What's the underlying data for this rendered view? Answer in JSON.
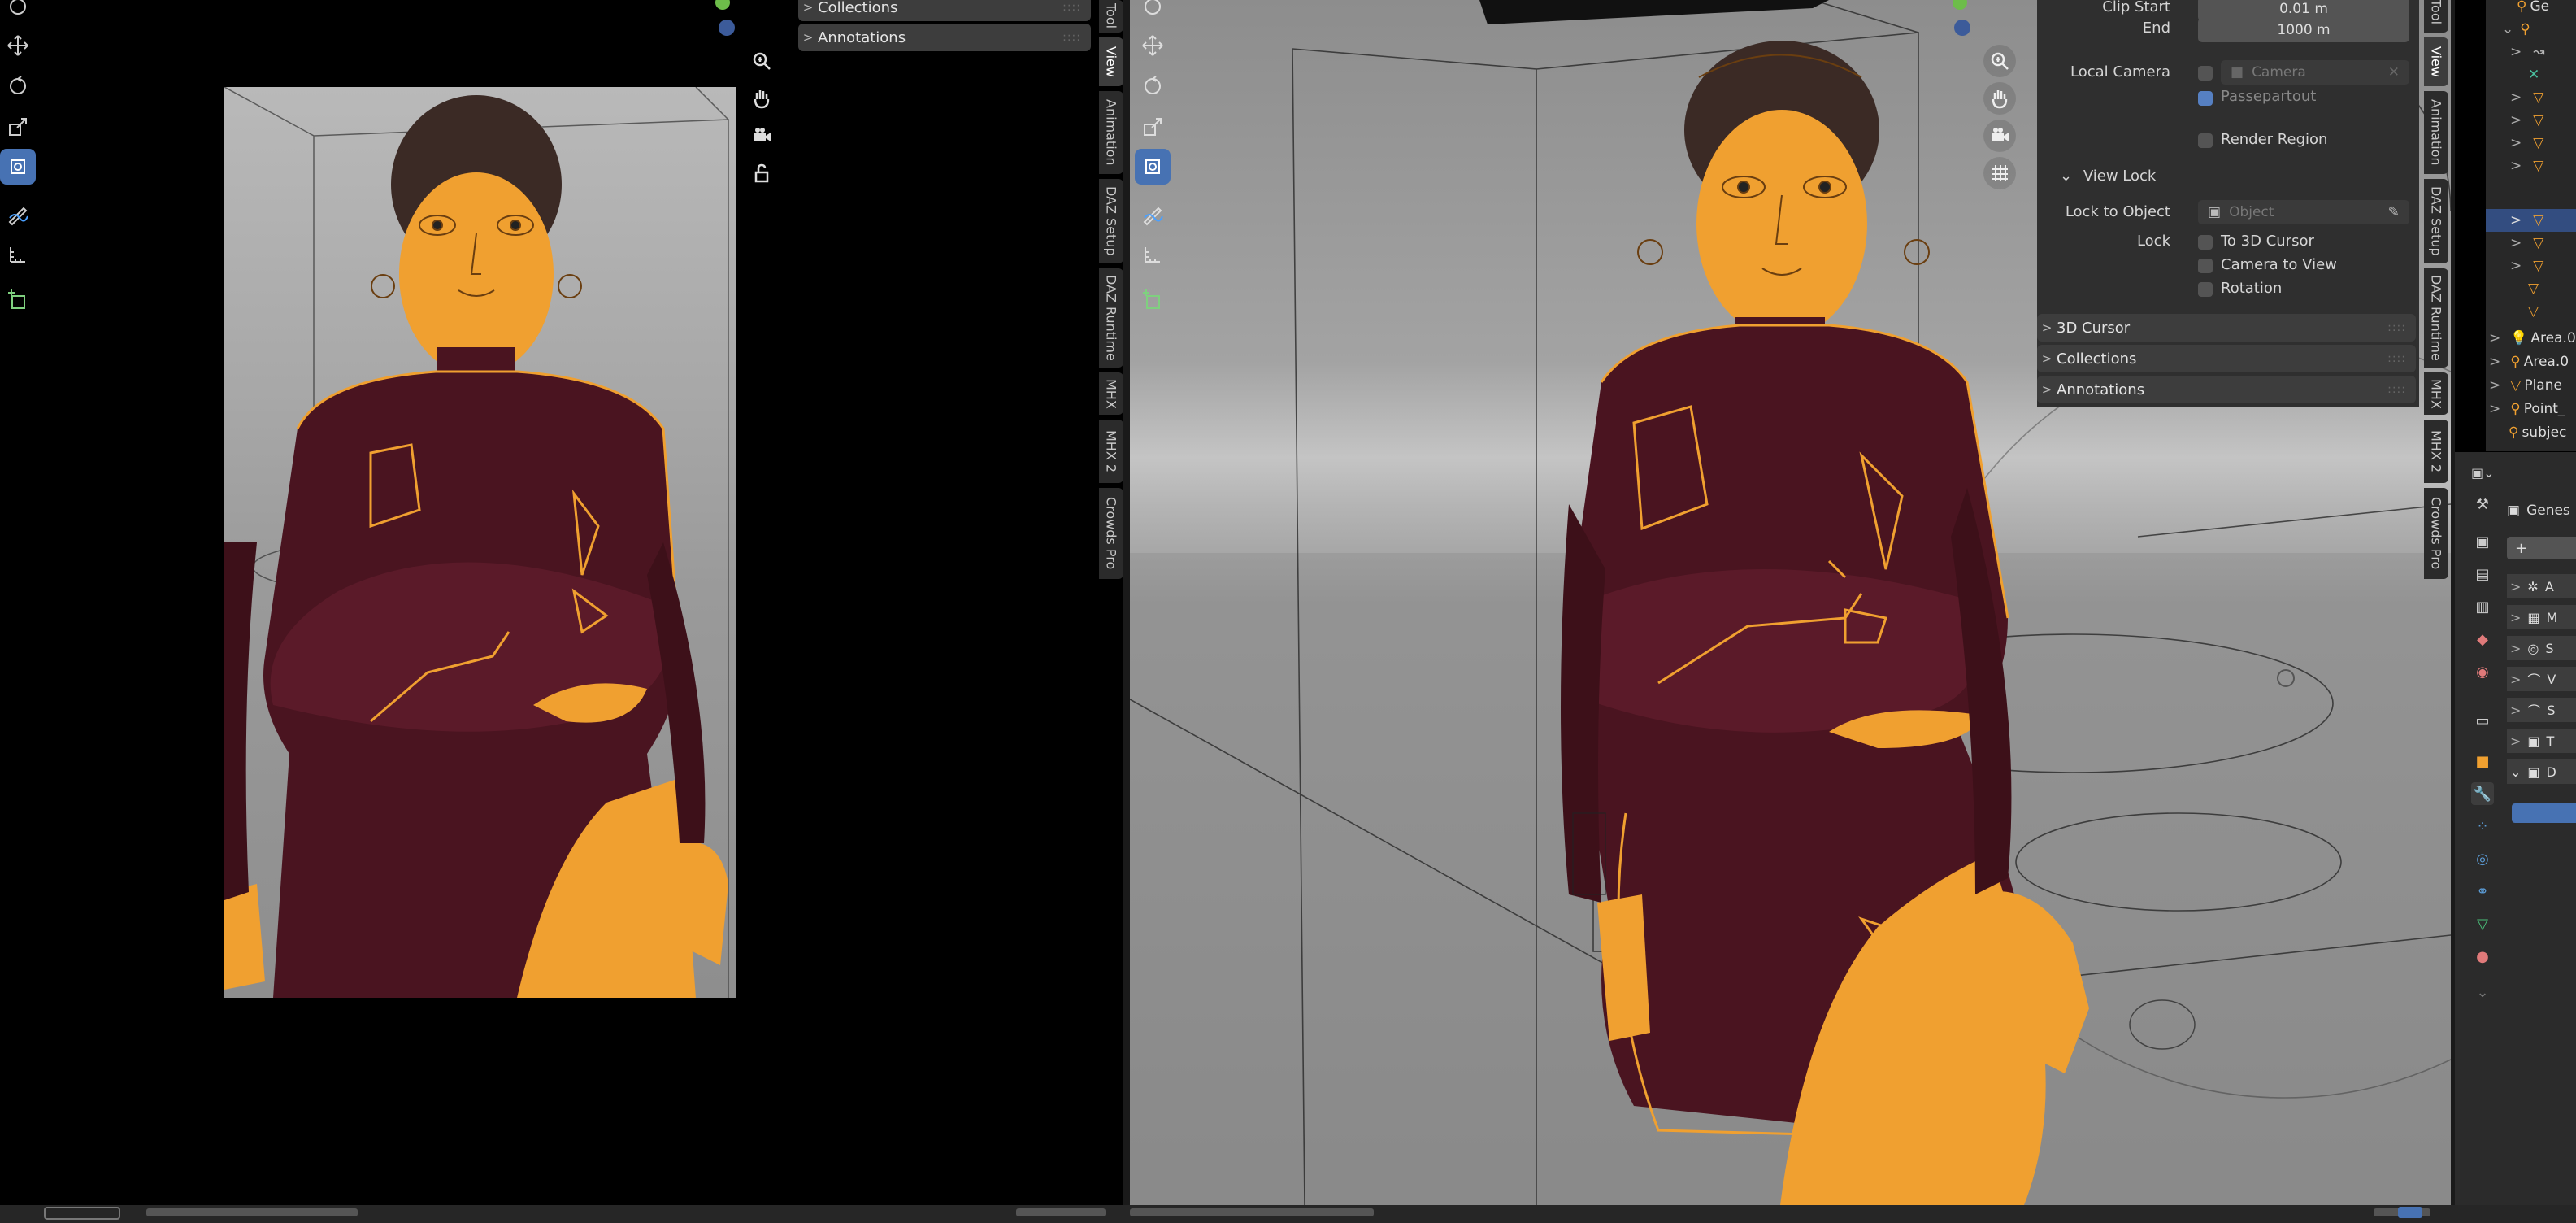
{
  "left_panel": {
    "collections_label": "Collections",
    "annotations_label": "Annotations"
  },
  "side_tabs_left": [
    "Tool",
    "View",
    "Animation",
    "DAZ Setup",
    "DAZ Runtime",
    "MHX",
    "MHX 2",
    "Crowds Pro"
  ],
  "side_tabs_right": [
    "Tool",
    "View",
    "Animation",
    "DAZ Setup",
    "DAZ Runtime",
    "MHX",
    "MHX 2",
    "Crowds Pro"
  ],
  "view_panel": {
    "clip_start_label": "Clip Start",
    "clip_start_value": "0.01 m",
    "end_label": "End",
    "end_value": "1000 m",
    "local_camera_label": "Local Camera",
    "camera_placeholder": "Camera",
    "passepartout_label": "Passepartout",
    "render_region_label": "Render Region",
    "view_lock_label": "View Lock",
    "lock_to_object_label": "Lock to Object",
    "object_placeholder": "Object",
    "lock_label": "Lock",
    "to_3d_cursor_label": "To 3D Cursor",
    "camera_to_view_label": "Camera to View",
    "rotation_label": "Rotation",
    "cursor_section": "3D Cursor",
    "collections_section": "Collections",
    "annotations_section": "Annotations"
  },
  "outliner": {
    "items": [
      "Ge",
      "",
      "",
      "",
      "",
      "",
      "",
      "",
      "",
      "",
      "",
      "",
      "Area.0",
      "Area.0",
      "Plane",
      "Point_",
      "subjec"
    ]
  },
  "properties": {
    "object_name": "Genes",
    "add_label": "+",
    "modifier_rows": [
      "A",
      "M",
      "S",
      "V",
      "S",
      "T",
      "D"
    ]
  },
  "colors": {
    "accent_blue": "#4772b3",
    "selection_orange": "#f0a030",
    "dress_maroon": "#4a1420"
  }
}
